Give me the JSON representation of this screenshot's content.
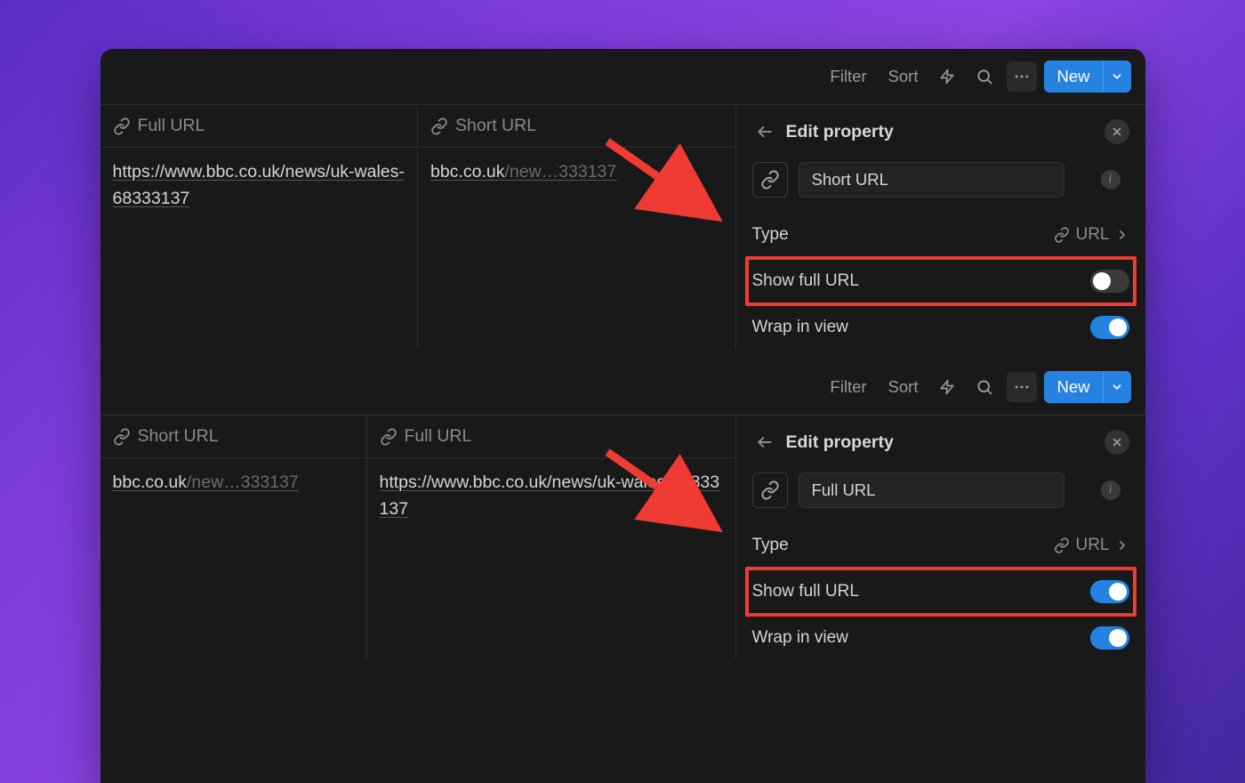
{
  "toolbar": {
    "filter": "Filter",
    "sort": "Sort",
    "new": "New"
  },
  "pane1": {
    "col1": {
      "header": "Full URL",
      "value": "https://www.bbc.co.uk/news/uk-wales-68333137"
    },
    "col2": {
      "header": "Short URL",
      "prefix": "bbc.co.uk",
      "dim": "/new…333137"
    },
    "side": {
      "title": "Edit property",
      "name": "Short URL",
      "type_label": "Type",
      "type_value": "URL",
      "show_full_label": "Show full URL",
      "show_full_on": false,
      "wrap_label": "Wrap in view",
      "wrap_on": true
    }
  },
  "pane2": {
    "col1": {
      "header": "Short URL",
      "prefix": "bbc.co.uk",
      "dim": "/new…333137"
    },
    "col2": {
      "header": "Full URL",
      "value": "https://www.bbc.co.uk/news/uk-wales-68333137"
    },
    "side": {
      "title": "Edit property",
      "name": "Full URL",
      "type_label": "Type",
      "type_value": "URL",
      "show_full_label": "Show full URL",
      "show_full_on": true,
      "wrap_label": "Wrap in view",
      "wrap_on": true
    }
  }
}
